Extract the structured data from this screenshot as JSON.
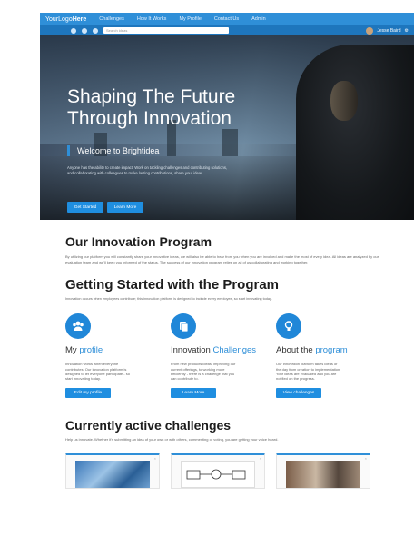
{
  "nav": {
    "logo_prefix": "YourLogo",
    "logo_bold": "Here",
    "links": [
      "Challenges",
      "How It Works",
      "My Profile",
      "Contact Us",
      "Admin"
    ]
  },
  "subnav": {
    "search_placeholder": "Search ideas",
    "user_name": "Jesse Baird"
  },
  "hero": {
    "title_line1": "Shaping The Future",
    "title_line2": "Through Innovation",
    "welcome": "Welcome to Brightidea",
    "body": "Anyone has the ability to create impact. Work on tackling challenges and contributing solutions, and collaborating with colleagues to make lasting contributions, share your ideas.",
    "btn_start": "Get Started",
    "btn_more": "Learn More"
  },
  "program": {
    "title": "Our Innovation Program",
    "text": "By utilizing our platform you will constantly share your innovative ideas, we will also be able to hear from you when you are involved and make the most of every idea. All ideas are analyzed by our evaluation team and we'll keep you informed of the status. The success of our innovation program relies on all of us collaborating and working together."
  },
  "getting_started": {
    "title": "Getting Started with the Program",
    "text": "Innovation occurs when employees contribute; this innovation platform is designed to include every employee, so start innovating today."
  },
  "columns": [
    {
      "title_plain": "My ",
      "title_accent": "profile",
      "text": "Innovation works when everyone contributes. Our innovation platform is designed to let everyone participate - so start innovating today.",
      "button": "Edit my profile",
      "icon": "people-icon"
    },
    {
      "title_plain": "Innovation ",
      "title_accent": "Challenges",
      "text": "From new products ideas, improving our current offerings, to working more efficiently - there is a challenge that you can contribute to.",
      "button": "Learn More",
      "icon": "document-icon"
    },
    {
      "title_plain": "About the ",
      "title_accent": "program",
      "text": "Our innovation platform takes ideas of the day from creation to implementation. Your ideas are evaluated and you are notified on the progress.",
      "button": "View challenges",
      "icon": "lightbulb-icon"
    }
  ],
  "challenges": {
    "title": "Currently active challenges",
    "text": "Help us innovate. Whether it's submitting an idea of your own or with others, commenting or voting, you are getting your voice heard."
  },
  "colors": {
    "accent": "#2f8fd8",
    "nav_dark": "#1e76bd",
    "button": "#1f8ee0"
  }
}
